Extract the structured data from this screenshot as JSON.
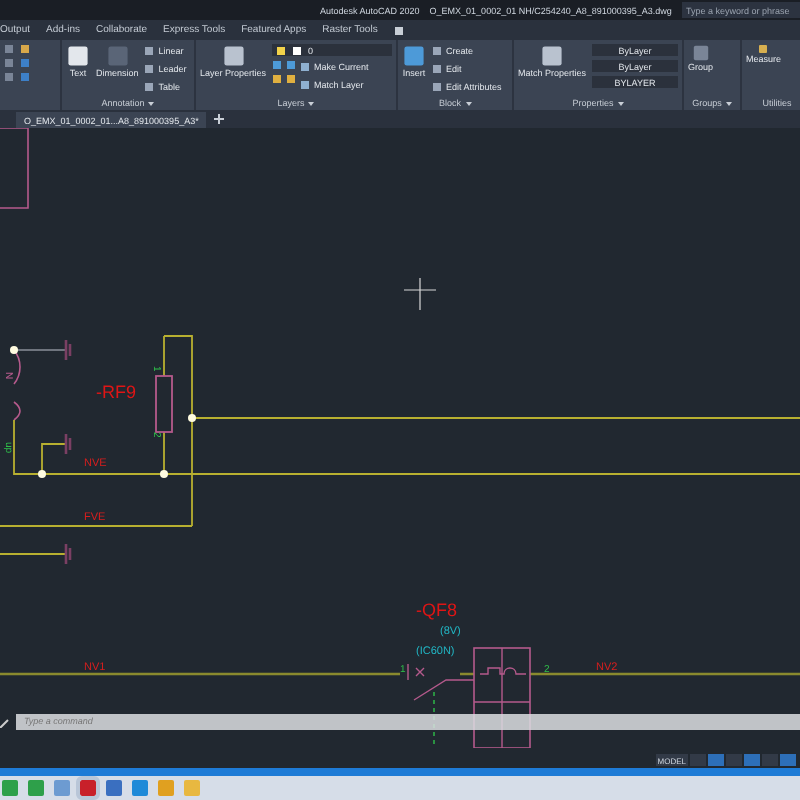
{
  "title_bar": {
    "app": "Autodesk AutoCAD 2020",
    "file": "O_EMX_01_0002_01 NH/C254240_A8_891000395_A3.dwg",
    "search": {
      "placeholder": "Type a keyword or phrase"
    }
  },
  "ribbon_tabs": [
    {
      "label": "Output",
      "selected": false
    },
    {
      "label": "Add-ins",
      "selected": false
    },
    {
      "label": "Collaborate",
      "selected": false
    },
    {
      "label": "Express Tools",
      "selected": false
    },
    {
      "label": "Featured Apps",
      "selected": false
    },
    {
      "label": "Raster Tools",
      "selected": false
    }
  ],
  "annotation": {
    "title": "Annotation",
    "large": [
      "Text",
      "Dimension"
    ],
    "small": [
      "Linear",
      "Leader",
      "Table"
    ]
  },
  "layers": {
    "title": "Layers",
    "large": "Layer Properties",
    "layer": "0",
    "small": [
      "Make Current",
      "Match Layer"
    ]
  },
  "block": {
    "title": "Block",
    "large": "Insert",
    "small": [
      "Create",
      "Edit",
      "Edit Attributes"
    ]
  },
  "properties": {
    "title": "Properties",
    "large": "Match Properties",
    "combos": [
      "ByLayer",
      "ByLayer",
      "BYLAYER"
    ]
  },
  "groups": {
    "title": "Groups",
    "large": "Group"
  },
  "utilities": {
    "title": "Utilities",
    "large": "Measure"
  },
  "file_tabs": [
    {
      "label": "O_EMX_01_0002_01...A8_891000395_A3*",
      "selected": true
    }
  ],
  "drawing_labels": [
    {
      "text": "N",
      "kind": "terminal"
    },
    {
      "text": "up",
      "kind": "pin"
    },
    {
      "text": "-RF9",
      "kind": "device"
    },
    {
      "text": "1",
      "kind": "pin"
    },
    {
      "text": "2",
      "kind": "pin"
    },
    {
      "text": "NVE",
      "kind": "wire"
    },
    {
      "text": "FVE",
      "kind": "wire"
    },
    {
      "text": "-QF8",
      "kind": "device"
    },
    {
      "text": "(8V)",
      "kind": "spec"
    },
    {
      "text": "(IC60N)",
      "kind": "spec"
    },
    {
      "text": "NV1",
      "kind": "wire"
    },
    {
      "text": "1",
      "kind": "pin"
    },
    {
      "text": "2",
      "kind": "pin"
    },
    {
      "text": "NV2",
      "kind": "wire"
    }
  ],
  "command_line": {
    "placeholder": "Type a command"
  },
  "status_bar": {
    "space": "MODEL"
  }
}
